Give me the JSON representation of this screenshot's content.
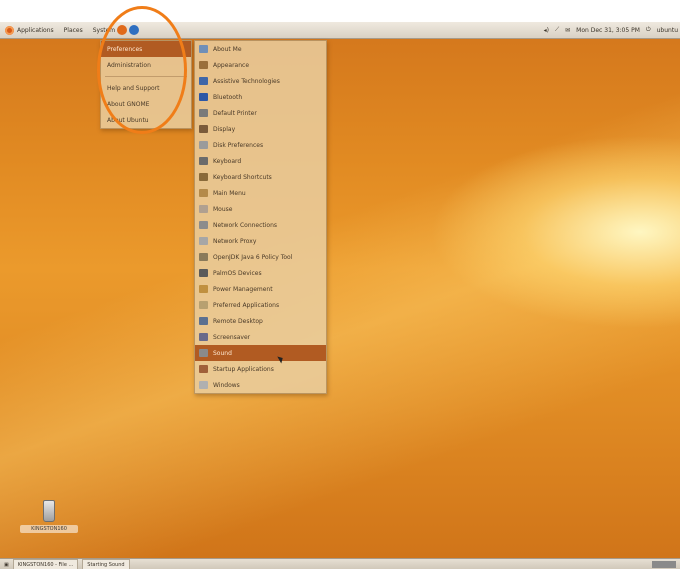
{
  "top_panel": {
    "applications": "Applications",
    "places": "Places",
    "system": "System",
    "clock": "Mon Dec 31, 3:05 PM",
    "user": "ubuntu"
  },
  "system_menu": {
    "items": [
      {
        "label": "Preferences",
        "active": true
      },
      {
        "label": "Administration",
        "active": false
      },
      {
        "label": "Help and Support",
        "active": false
      },
      {
        "label": "About GNOME",
        "active": false
      },
      {
        "label": "About Ubuntu",
        "active": false
      }
    ]
  },
  "preferences_menu": {
    "items": [
      {
        "label": "About Me",
        "color": "#6f8fb8"
      },
      {
        "label": "Appearance",
        "color": "#9a6f3a"
      },
      {
        "label": "Assistive Technologies",
        "color": "#3f66a8"
      },
      {
        "label": "Bluetooth",
        "color": "#2d57a6"
      },
      {
        "label": "Default Printer",
        "color": "#7a7a7a"
      },
      {
        "label": "Display",
        "color": "#7b5b3a"
      },
      {
        "label": "Disk Preferences",
        "color": "#9b9b9b"
      },
      {
        "label": "Keyboard",
        "color": "#6b6b6b"
      },
      {
        "label": "Keyboard Shortcuts",
        "color": "#8a6a3a"
      },
      {
        "label": "Main Menu",
        "color": "#b48a4a"
      },
      {
        "label": "Mouse",
        "color": "#b0a090"
      },
      {
        "label": "Network Connections",
        "color": "#8c8c8c"
      },
      {
        "label": "Network Proxy",
        "color": "#a6a6a6"
      },
      {
        "label": "OpenJDK Java 6 Policy Tool",
        "color": "#8a7a5a"
      },
      {
        "label": "PalmOS Devices",
        "color": "#5a5a5a"
      },
      {
        "label": "Power Management",
        "color": "#c09040"
      },
      {
        "label": "Preferred Applications",
        "color": "#b8a070"
      },
      {
        "label": "Remote Desktop",
        "color": "#5c7090"
      },
      {
        "label": "Screensaver",
        "color": "#6a6a8a"
      },
      {
        "label": "Sound",
        "color": "#8a8a8a",
        "active": true
      },
      {
        "label": "Startup Applications",
        "color": "#a0603a"
      },
      {
        "label": "Windows",
        "color": "#b0b0b0"
      }
    ]
  },
  "desktop_icon": {
    "label": "KINGSTON160"
  },
  "bottom_panel": {
    "task1": "KINGSTON160 - File ...",
    "task2": "Starting Sound"
  },
  "colors": {
    "accent": "#f07d18",
    "menu_active": "#b15b22",
    "desktop": "#e6901f"
  }
}
